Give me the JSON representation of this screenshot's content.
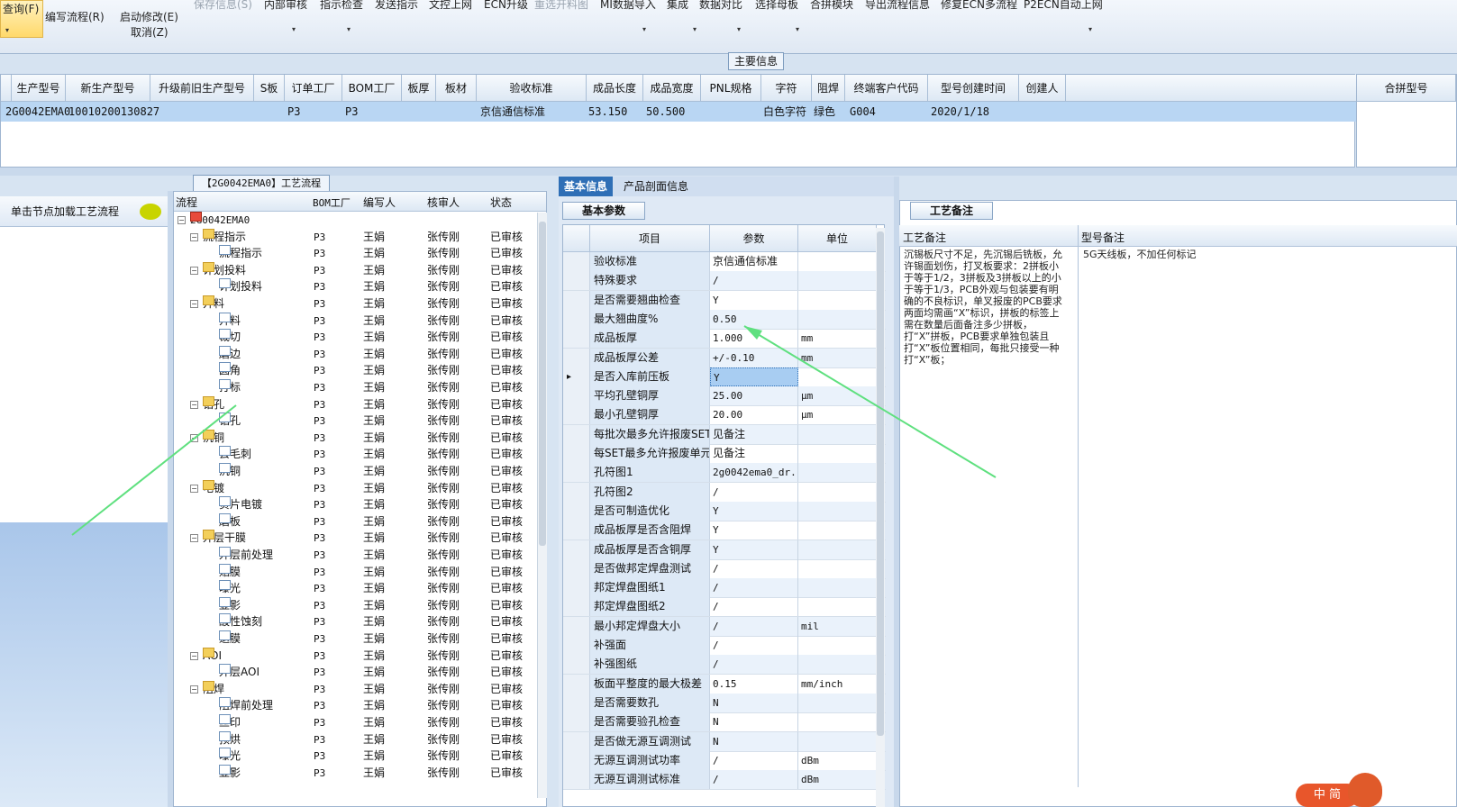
{
  "toolbar": {
    "items": [
      {
        "label": "查询(F)",
        "dim": false
      },
      {
        "label": "编写流程(R)",
        "dim": false
      },
      {
        "label": "启动修改(E)",
        "dim": false
      },
      {
        "label": "取消(Z)",
        "dim": false
      },
      {
        "label": "保存信息(S)",
        "dim": true
      },
      {
        "label": "内部审核",
        "dim": false
      },
      {
        "label": "指示检查",
        "dim": false
      },
      {
        "label": "发送指示",
        "dim": false
      },
      {
        "label": "文控上网",
        "dim": false
      },
      {
        "label": "ECN升级",
        "dim": false
      },
      {
        "label": "重选开料图",
        "dim": true
      },
      {
        "label": "MI数据导入",
        "dim": false
      },
      {
        "label": "集成",
        "dim": false
      },
      {
        "label": "数据对比",
        "dim": false
      },
      {
        "label": "选择母板",
        "dim": false
      },
      {
        "label": "合拼模块",
        "dim": false
      },
      {
        "label": "导出流程信息",
        "dim": false
      },
      {
        "label": "修复ECN多流程",
        "dim": false
      },
      {
        "label": "P2ECN自动上网",
        "dim": false
      }
    ]
  },
  "main_info": {
    "title": "主要信息",
    "columns": [
      "生产型号",
      "新生产型号",
      "升级前旧生产型号",
      "S板",
      "订单工厂",
      "BOM工厂",
      "板厚",
      "板材",
      "验收标准",
      "成品长度",
      "成品宽度",
      "PNL规格",
      "字符",
      "阻焊",
      "终端客户代码",
      "型号创建时间",
      "创建人"
    ],
    "row": [
      "2G0042EMA0",
      "10010200130827",
      "",
      "",
      "P3",
      "P3",
      "",
      "",
      "京信通信标准",
      "53.150",
      "50.500",
      "",
      "白色字符",
      "绿色",
      "G004",
      "2020/1/18",
      ""
    ],
    "merge_header": "合拼型号"
  },
  "left_panel": {
    "hint": "单击节点加载工艺流程"
  },
  "tree": {
    "tab": "【2G0042EMA0】工艺流程",
    "headers": [
      "流程",
      "BOM工厂",
      "编写人",
      "核审人",
      "状态"
    ],
    "rows": [
      {
        "level": 0,
        "type": "root",
        "name": "2G0042EMA0",
        "bom": "",
        "writer": "",
        "reviewer": "",
        "status": ""
      },
      {
        "level": 1,
        "type": "folder",
        "name": "流程指示",
        "bom": "P3",
        "writer": "王娟",
        "reviewer": "张传刚",
        "status": "已审核"
      },
      {
        "level": 2,
        "type": "doc",
        "name": "流程指示",
        "bom": "P3",
        "writer": "王娟",
        "reviewer": "张传刚",
        "status": "已审核"
      },
      {
        "level": 1,
        "type": "folder",
        "name": "计划投料",
        "bom": "P3",
        "writer": "王娟",
        "reviewer": "张传刚",
        "status": "已审核"
      },
      {
        "level": 2,
        "type": "doc",
        "name": "计划投料",
        "bom": "P3",
        "writer": "王娟",
        "reviewer": "张传刚",
        "status": "已审核"
      },
      {
        "level": 1,
        "type": "folder",
        "name": "开料",
        "bom": "P3",
        "writer": "王娟",
        "reviewer": "张传刚",
        "status": "已审核"
      },
      {
        "level": 2,
        "type": "doc",
        "name": "开料",
        "bom": "P3",
        "writer": "王娟",
        "reviewer": "张传刚",
        "status": "已审核"
      },
      {
        "level": 2,
        "type": "doc",
        "name": "裁切",
        "bom": "P3",
        "writer": "王娟",
        "reviewer": "张传刚",
        "status": "已审核"
      },
      {
        "level": 2,
        "type": "doc",
        "name": "磨边",
        "bom": "P3",
        "writer": "王娟",
        "reviewer": "张传刚",
        "status": "已审核"
      },
      {
        "level": 2,
        "type": "doc",
        "name": "圆角",
        "bom": "P3",
        "writer": "王娟",
        "reviewer": "张传刚",
        "status": "已审核"
      },
      {
        "level": 2,
        "type": "doc",
        "name": "打标",
        "bom": "P3",
        "writer": "王娟",
        "reviewer": "张传刚",
        "status": "已审核"
      },
      {
        "level": 1,
        "type": "folder",
        "name": "钻孔",
        "bom": "P3",
        "writer": "王娟",
        "reviewer": "张传刚",
        "status": "已审核"
      },
      {
        "level": 2,
        "type": "doc",
        "name": "钻孔",
        "bom": "P3",
        "writer": "王娟",
        "reviewer": "张传刚",
        "status": "已审核"
      },
      {
        "level": 1,
        "type": "folder",
        "name": "沉铜",
        "bom": "P3",
        "writer": "王娟",
        "reviewer": "张传刚",
        "status": "已审核"
      },
      {
        "level": 2,
        "type": "doc",
        "name": "去毛刺",
        "bom": "P3",
        "writer": "王娟",
        "reviewer": "张传刚",
        "status": "已审核"
      },
      {
        "level": 2,
        "type": "doc",
        "name": "沉铜",
        "bom": "P3",
        "writer": "王娟",
        "reviewer": "张传刚",
        "status": "已审核"
      },
      {
        "level": 1,
        "type": "folder",
        "name": "电镀",
        "bom": "P3",
        "writer": "王娟",
        "reviewer": "张传刚",
        "status": "已审核"
      },
      {
        "level": 2,
        "type": "doc",
        "name": "负片电镀",
        "bom": "P3",
        "writer": "王娟",
        "reviewer": "张传刚",
        "status": "已审核"
      },
      {
        "level": 2,
        "type": "doc",
        "name": "磨板",
        "bom": "P3",
        "writer": "王娟",
        "reviewer": "张传刚",
        "status": "已审核"
      },
      {
        "level": 1,
        "type": "folder",
        "name": "外层干膜",
        "bom": "P3",
        "writer": "王娟",
        "reviewer": "张传刚",
        "status": "已审核"
      },
      {
        "level": 2,
        "type": "doc",
        "name": "外层前处理",
        "bom": "P3",
        "writer": "王娟",
        "reviewer": "张传刚",
        "status": "已审核"
      },
      {
        "level": 2,
        "type": "doc",
        "name": "贴膜",
        "bom": "P3",
        "writer": "王娟",
        "reviewer": "张传刚",
        "status": "已审核"
      },
      {
        "level": 2,
        "type": "doc",
        "name": "曝光",
        "bom": "P3",
        "writer": "王娟",
        "reviewer": "张传刚",
        "status": "已审核"
      },
      {
        "level": 2,
        "type": "doc",
        "name": "显影",
        "bom": "P3",
        "writer": "王娟",
        "reviewer": "张传刚",
        "status": "已审核"
      },
      {
        "level": 2,
        "type": "doc",
        "name": "酸性蚀刻",
        "bom": "P3",
        "writer": "王娟",
        "reviewer": "张传刚",
        "status": "已审核"
      },
      {
        "level": 2,
        "type": "doc",
        "name": "退膜",
        "bom": "P3",
        "writer": "王娟",
        "reviewer": "张传刚",
        "status": "已审核"
      },
      {
        "level": 1,
        "type": "folder",
        "name": "AOI",
        "bom": "P3",
        "writer": "王娟",
        "reviewer": "张传刚",
        "status": "已审核"
      },
      {
        "level": 2,
        "type": "doc",
        "name": "外层AOI",
        "bom": "P3",
        "writer": "王娟",
        "reviewer": "张传刚",
        "status": "已审核"
      },
      {
        "level": 1,
        "type": "folder",
        "name": "阻焊",
        "bom": "P3",
        "writer": "王娟",
        "reviewer": "张传刚",
        "status": "已审核"
      },
      {
        "level": 2,
        "type": "doc",
        "name": "阻焊前处理",
        "bom": "P3",
        "writer": "王娟",
        "reviewer": "张传刚",
        "status": "已审核"
      },
      {
        "level": 2,
        "type": "doc",
        "name": "丝印",
        "bom": "P3",
        "writer": "王娟",
        "reviewer": "张传刚",
        "status": "已审核"
      },
      {
        "level": 2,
        "type": "doc",
        "name": "预烘",
        "bom": "P3",
        "writer": "王娟",
        "reviewer": "张传刚",
        "status": "已审核"
      },
      {
        "level": 2,
        "type": "doc",
        "name": "曝光",
        "bom": "P3",
        "writer": "王娟",
        "reviewer": "张传刚",
        "status": "已审核"
      },
      {
        "level": 2,
        "type": "doc",
        "name": "显影",
        "bom": "P3",
        "writer": "王娟",
        "reviewer": "张传刚",
        "status": "已审核"
      }
    ]
  },
  "tabs": {
    "basic": "基本信息",
    "profile": "产品剖面信息",
    "basic_params": "基本参数"
  },
  "params": {
    "headers": [
      "项目",
      "参数",
      "单位"
    ],
    "rows": [
      {
        "item": "验收标准",
        "value": "京信通信标准",
        "unit": ""
      },
      {
        "item": "特殊要求",
        "value": "/",
        "unit": ""
      },
      {
        "item": "是否需要翘曲检查",
        "value": "Y",
        "unit": ""
      },
      {
        "item": "最大翘曲度%",
        "value": "0.50",
        "unit": ""
      },
      {
        "item": "成品板厚",
        "value": "1.000",
        "unit": "mm"
      },
      {
        "item": "成品板厚公差",
        "value": "+/-0.10",
        "unit": "mm"
      },
      {
        "item": "是否入库前压板",
        "value": "Y",
        "unit": "",
        "selected": true
      },
      {
        "item": "平均孔壁铜厚",
        "value": "25.00",
        "unit": "μm"
      },
      {
        "item": "最小孔壁铜厚",
        "value": "20.00",
        "unit": "μm"
      },
      {
        "item": "每批次最多允许报废SET",
        "value": "见备注",
        "unit": ""
      },
      {
        "item": "每SET最多允许报废单元",
        "value": "见备注",
        "unit": ""
      },
      {
        "item": "孔符图1",
        "value": "2g0042ema0_dr...",
        "unit": ""
      },
      {
        "item": "孔符图2",
        "value": "/",
        "unit": ""
      },
      {
        "item": "是否可制造优化",
        "value": "Y",
        "unit": ""
      },
      {
        "item": "成品板厚是否含阻焊",
        "value": "Y",
        "unit": ""
      },
      {
        "item": "成品板厚是否含铜厚",
        "value": "Y",
        "unit": ""
      },
      {
        "item": "是否做邦定焊盘测试",
        "value": "/",
        "unit": ""
      },
      {
        "item": "邦定焊盘图纸1",
        "value": "/",
        "unit": ""
      },
      {
        "item": "邦定焊盘图纸2",
        "value": "/",
        "unit": ""
      },
      {
        "item": "最小邦定焊盘大小",
        "value": "/",
        "unit": "mil"
      },
      {
        "item": "补强面",
        "value": "/",
        "unit": ""
      },
      {
        "item": "补强图纸",
        "value": "/",
        "unit": ""
      },
      {
        "item": "板面平整度的最大极差",
        "value": "0.15",
        "unit": "mm/inch"
      },
      {
        "item": "是否需要数孔",
        "value": "N",
        "unit": ""
      },
      {
        "item": "是否需要验孔检查",
        "value": "N",
        "unit": ""
      },
      {
        "item": "是否做无源互调测试",
        "value": "N",
        "unit": ""
      },
      {
        "item": "无源互调测试功率",
        "value": "/",
        "unit": "dBm"
      },
      {
        "item": "无源互调测试标准",
        "value": "/",
        "unit": "dBm"
      }
    ]
  },
  "notes": {
    "tab": "工艺备注",
    "col1": "工艺备注",
    "col2": "型号备注",
    "process_note": "沉锡板尺寸不足，先沉锡后铣板，允许锡面划伤，打叉板要求：2拼板小于等于1/2，3拼板及3拼板以上的小于等于1/3，PCB外观与包装要有明确的不良标识，单叉报废的PCB要求两面均需画“X”标识，拼板的标签上需在数量后面备注多少拼板，打“X”拼板，PCB要求单独包装且打“X”板位置相同，每批只接受一种打“X”板；",
    "model_note": "5G天线板，不加任何标记"
  },
  "mascot_text": "中 简"
}
